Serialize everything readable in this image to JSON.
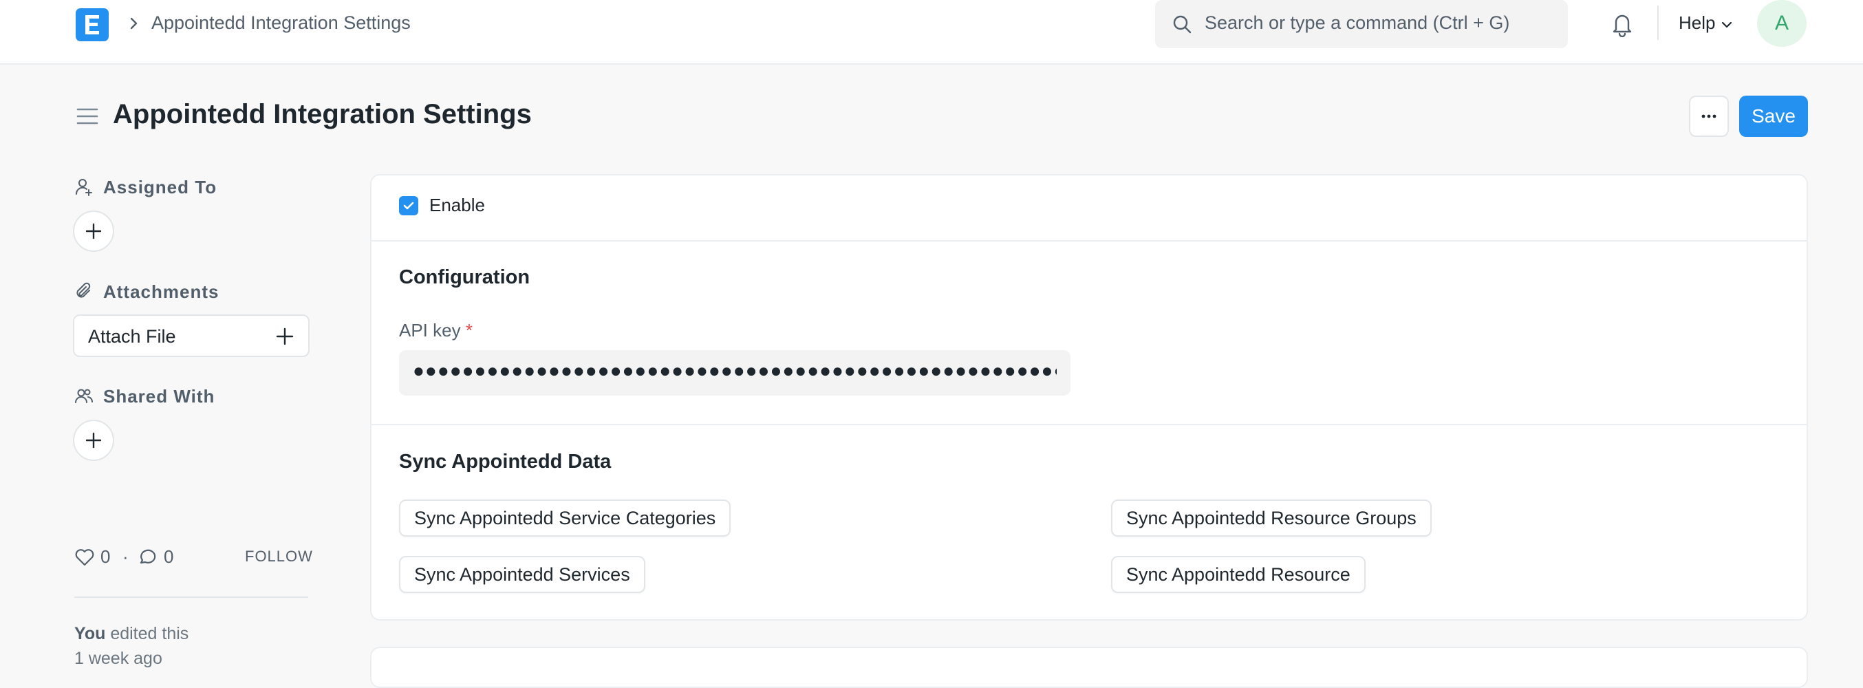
{
  "navbar": {
    "breadcrumb": "Appointedd Integration Settings",
    "search_placeholder": "Search or type a command (Ctrl + G)",
    "help_label": "Help",
    "avatar_initial": "A"
  },
  "page": {
    "title": "Appointedd Integration Settings",
    "more_label": "···",
    "save_label": "Save"
  },
  "sidebar": {
    "assigned_to_label": "Assigned To",
    "attachments_label": "Attachments",
    "attach_file_label": "Attach File",
    "shared_with_label": "Shared With",
    "likes_count": "0",
    "separator": "·",
    "comments_count": "0",
    "follow_label": "FOLLOW",
    "activity_actor": "You",
    "activity_action": " edited this",
    "activity_time": "1 week ago"
  },
  "form": {
    "enable_label": "Enable",
    "enable_checked": true,
    "configuration_title": "Configuration",
    "api_key_label": "API key",
    "api_key_required_mark": "*",
    "api_key_masked": "●●●●●●●●●●●●●●●●●●●●●●●●●●●●●●●●●●●●●●●●●●●●●●●●●●●●●●●●●●●●●●●●●●●",
    "sync_title": "Sync Appointedd Data",
    "sync_buttons": {
      "service_categories": "Sync Appointedd Service Categories",
      "services": "Sync Appointedd Services",
      "resource_groups": "Sync Appointedd Resource Groups",
      "resource": "Sync Appointedd Resource"
    }
  },
  "colors": {
    "accent": "#2490ef",
    "required": "#e24c4c",
    "avatar_bg": "#e4f5e9",
    "avatar_fg": "#30a66d"
  }
}
